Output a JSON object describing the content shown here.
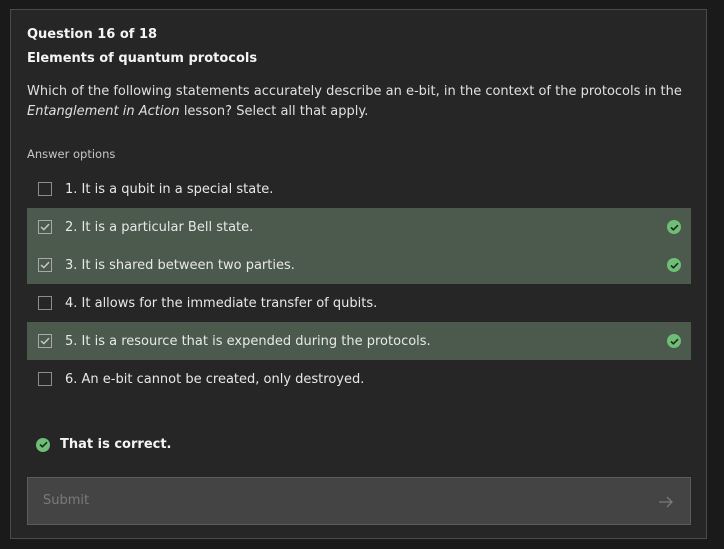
{
  "question": {
    "number_label": "Question 16 of 18",
    "title": "Elements of quantum protocols",
    "prompt_before": "Which of the following statements accurately describe an e-bit, in the context of the protocols in the ",
    "prompt_emphasis": "Entanglement in Action",
    "prompt_after": " lesson? Select all that apply."
  },
  "answers": {
    "label": "Answer options",
    "options": [
      {
        "label": "1. It is a qubit in a special state.",
        "selected": false,
        "correct": false
      },
      {
        "label": "2. It is a particular Bell state.",
        "selected": true,
        "correct": true
      },
      {
        "label": "3. It is shared between two parties.",
        "selected": true,
        "correct": true
      },
      {
        "label": "4. It allows for the immediate transfer of qubits.",
        "selected": false,
        "correct": false
      },
      {
        "label": "5. It is a resource that is expended during the protocols.",
        "selected": true,
        "correct": true
      },
      {
        "label": "6. An e-bit cannot be created, only destroyed.",
        "selected": false,
        "correct": false
      }
    ]
  },
  "feedback": {
    "text": "That is correct.",
    "icon": "check-circle-icon"
  },
  "submit": {
    "label": "Submit",
    "icon": "arrow-right-icon"
  },
  "colors": {
    "background": "#1a1a1a",
    "panel": "#262626",
    "selected_row": "#4b5a4c",
    "success": "#6fbe76",
    "submit_bg": "#444444"
  }
}
